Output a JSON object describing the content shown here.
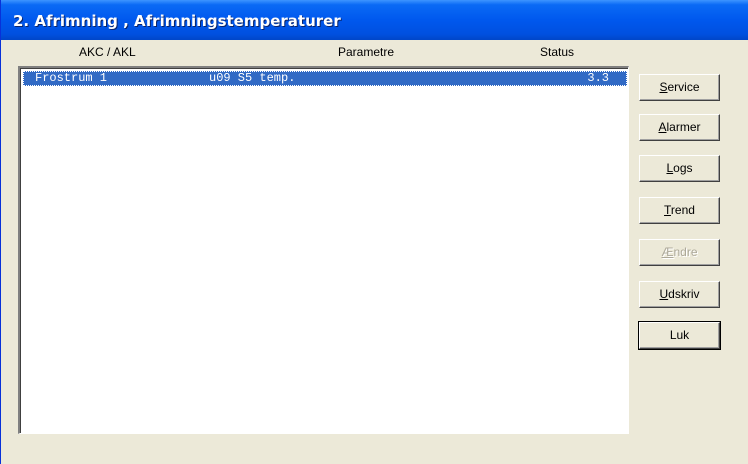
{
  "window": {
    "title": "2. Afrimning , Afrimningstemperaturer"
  },
  "columns": {
    "akc": "AKC / AKL",
    "param": "Parametre",
    "status": "Status"
  },
  "rows": [
    {
      "akc": "Frostrum 1",
      "param": "u09 S5 temp.",
      "status": "3.3",
      "selected": true
    }
  ],
  "buttons": [
    {
      "mnemonic": "S",
      "rest": "ervice",
      "enabled": true
    },
    {
      "mnemonic": "A",
      "rest": "larmer",
      "enabled": true
    },
    {
      "mnemonic": "L",
      "rest": "ogs",
      "enabled": true
    },
    {
      "mnemonic": "T",
      "rest": "rend",
      "enabled": true
    },
    {
      "mnemonic": "Æ",
      "rest": "ndre",
      "enabled": false
    },
    {
      "mnemonic": "U",
      "rest": "dskriv",
      "enabled": true
    },
    {
      "mnemonic": "",
      "rest": "Luk",
      "enabled": true
    }
  ],
  "colors": {
    "title_bar": "#0058ee",
    "selection": "#316ac5",
    "face": "#ece9d8"
  }
}
